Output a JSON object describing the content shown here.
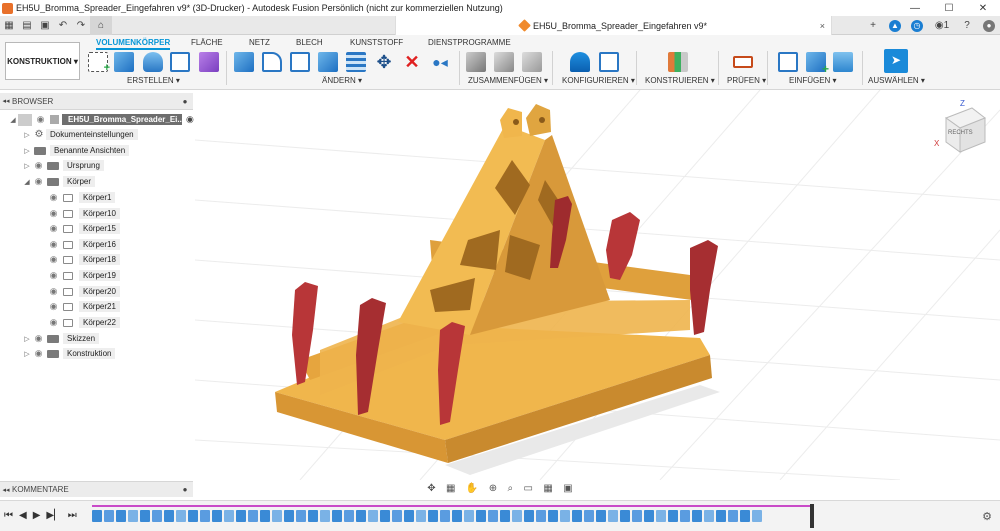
{
  "window": {
    "title": "EH5U_Bromma_Spreader_Eingefahren v9* (3D-Drucker) - Autodesk Fusion Persönlich (nicht zur kommerziellen Nutzung)",
    "minimize": "—",
    "maximize": "☐",
    "close": "✕"
  },
  "tabbar": {
    "doc_title": "EH5U_Bromma_Spreader_Eingefahren v9*",
    "close": "×",
    "add": "+",
    "notifications": "1"
  },
  "ribbon": {
    "workspace": "KONSTRUKTION ▾",
    "tabs": [
      "VOLUMENKÖRPER",
      "FLÄCHE",
      "NETZ",
      "BLECH",
      "KUNSTSTOFF",
      "DIENSTPROGRAMME"
    ],
    "groups": [
      "ERSTELLEN ▾",
      "ÄNDERN ▾",
      "ZUSAMMENFÜGEN ▾",
      "KONFIGURIEREN ▾",
      "KONSTRUIEREN ▾",
      "PRÜFEN ▾",
      "EINFÜGEN ▾",
      "AUSWÄHLEN ▾"
    ]
  },
  "browser": {
    "header": "BROWSER",
    "root": "EH5U_Bromma_Spreader_Ei...",
    "items": [
      "Dokumenteinstellungen",
      "Benannte Ansichten",
      "Ursprung",
      "Körper",
      "Skizzen",
      "Konstruktion"
    ],
    "bodies": [
      "Körper1",
      "Körper10",
      "Körper15",
      "Körper16",
      "Körper18",
      "Körper19",
      "Körper20",
      "Körper21",
      "Körper22"
    ]
  },
  "viewcube": {
    "face": "RECHTS",
    "axis_z": "Z",
    "axis_x": "X"
  },
  "comments": {
    "label": "KOMMENTARE"
  },
  "colors": {
    "model_yellow": "#e8a83e",
    "model_red": "#b83638",
    "accent": "#0696d7",
    "timeline": "#c94bc8"
  }
}
